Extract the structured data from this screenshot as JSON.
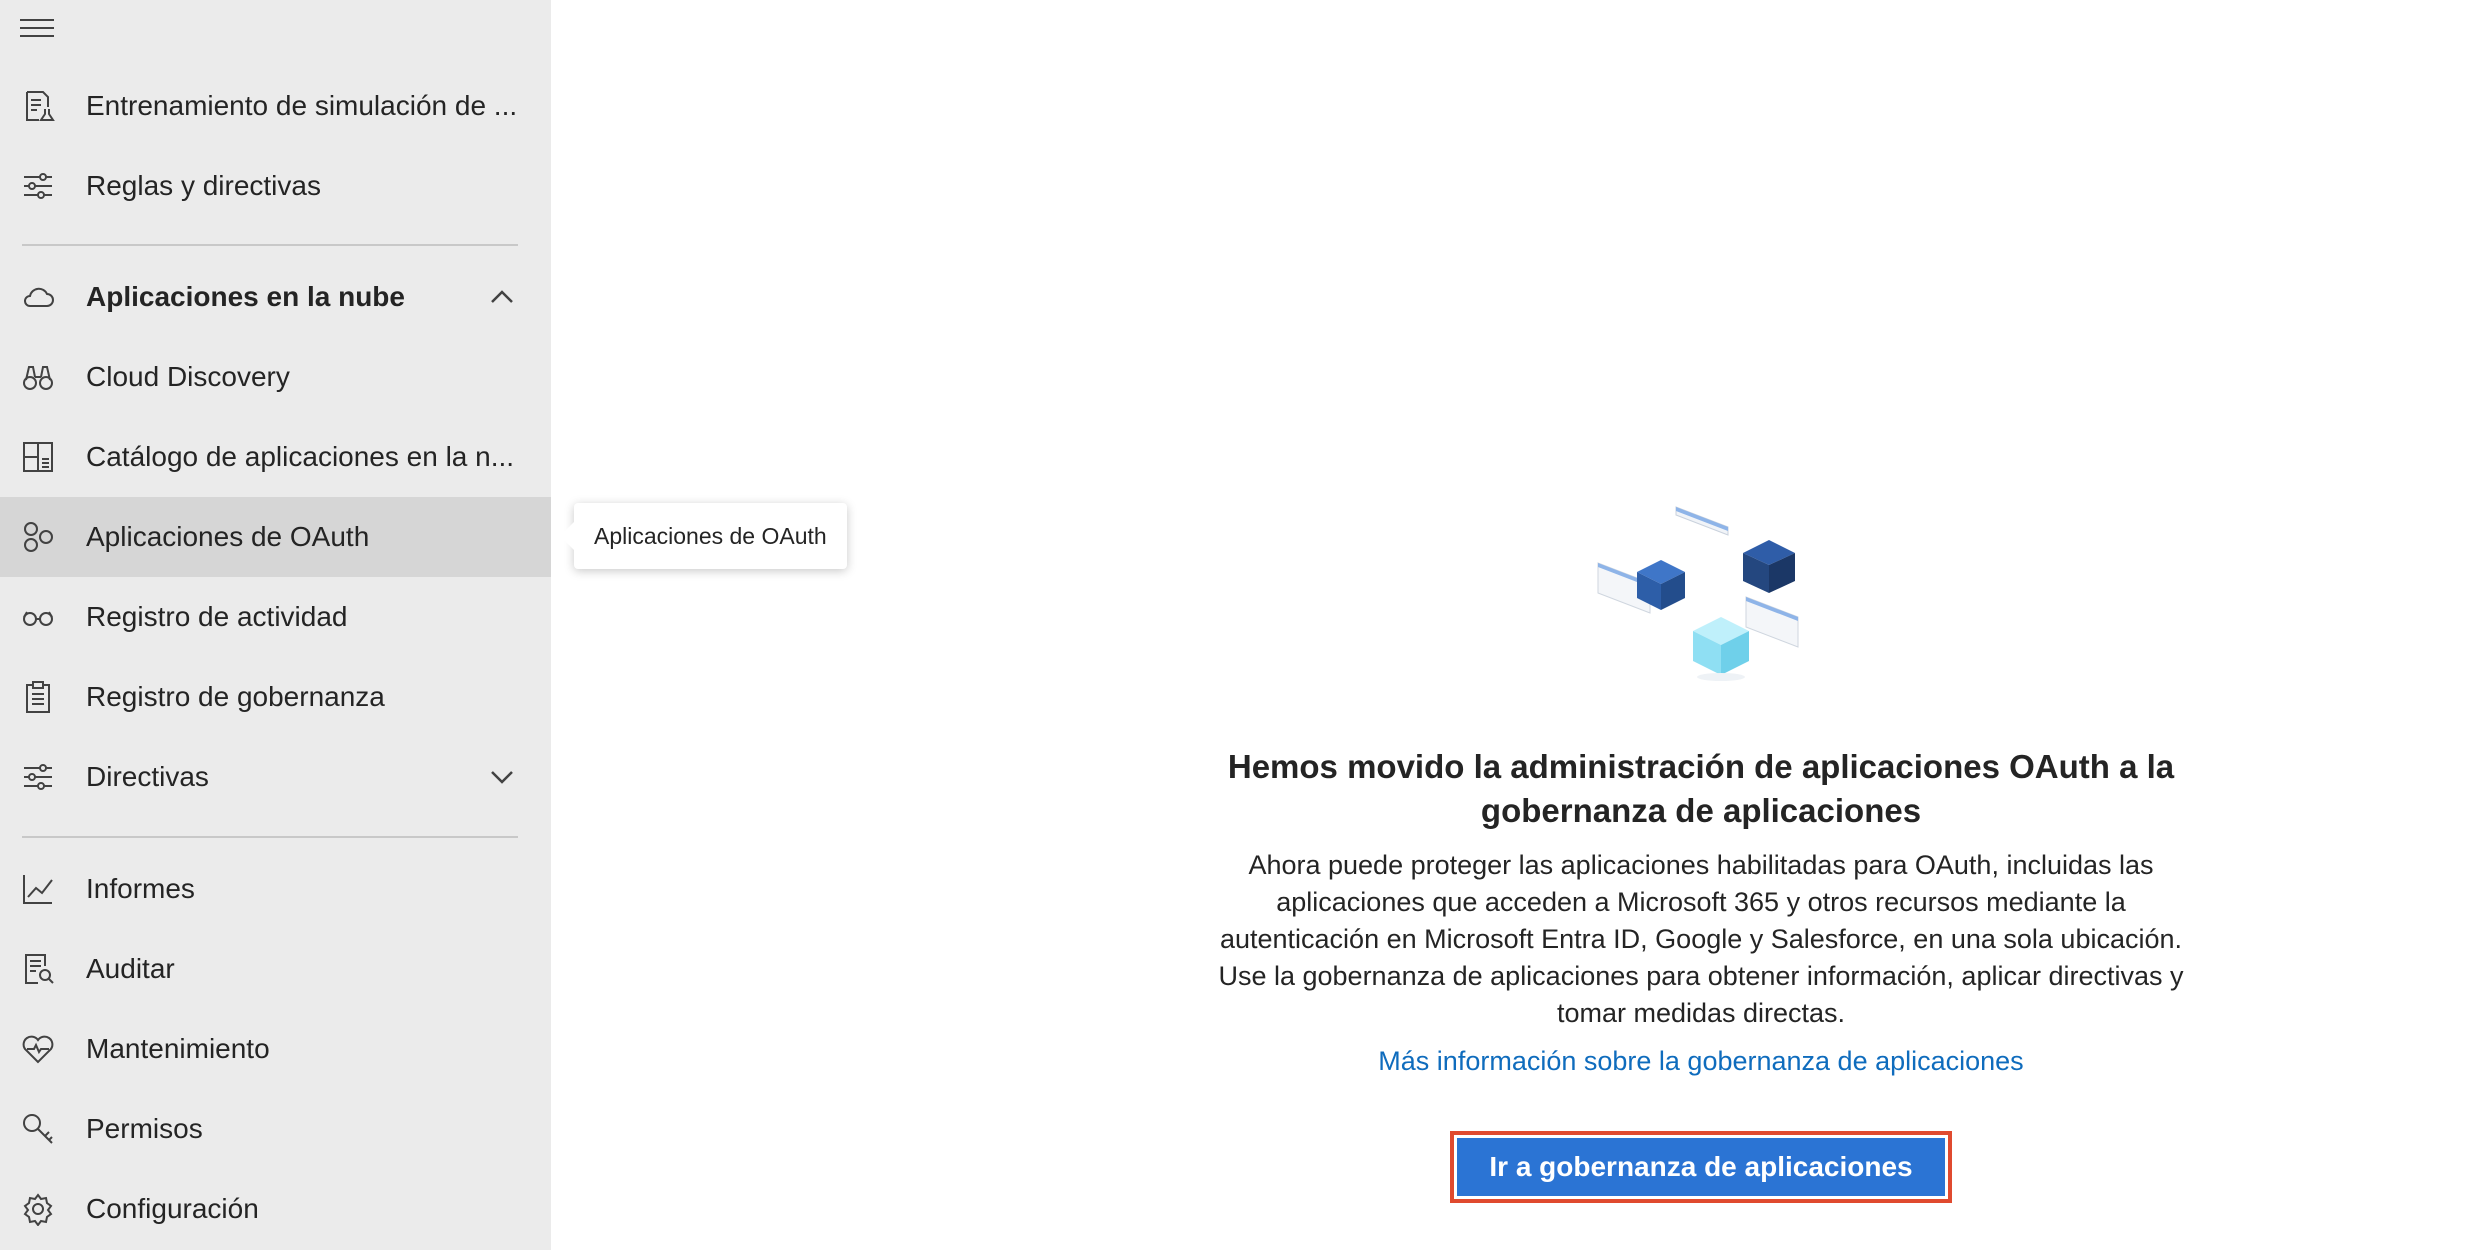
{
  "sidebar": {
    "items": [
      {
        "label": "Entrenamiento de simulación de ...",
        "icon": "lab-report-icon"
      },
      {
        "label": "Reglas y directivas",
        "icon": "sliders-icon"
      },
      {
        "label": "Aplicaciones en la nube",
        "icon": "cloud-icon",
        "expanded": true
      },
      {
        "label": "Cloud Discovery",
        "icon": "binoculars-icon"
      },
      {
        "label": "Catálogo de aplicaciones en la n...",
        "icon": "app-catalog-icon"
      },
      {
        "label": "Aplicaciones de OAuth",
        "icon": "oauth-apps-icon",
        "active": true
      },
      {
        "label": "Registro de actividad",
        "icon": "glasses-icon"
      },
      {
        "label": "Registro de gobernanza",
        "icon": "clipboard-icon"
      },
      {
        "label": "Directivas",
        "icon": "sliders-icon",
        "expanded": false
      },
      {
        "label": "Informes",
        "icon": "line-chart-icon"
      },
      {
        "label": "Auditar",
        "icon": "audit-icon"
      },
      {
        "label": "Mantenimiento",
        "icon": "heart-pulse-icon"
      },
      {
        "label": "Permisos",
        "icon": "key-icon"
      },
      {
        "label": "Configuración",
        "icon": "gear-icon"
      }
    ]
  },
  "tooltip": {
    "text": "Aplicaciones de OAuth"
  },
  "main": {
    "heading": "Hemos movido la administración de aplicaciones OAuth a la gobernanza de aplicaciones",
    "body": "Ahora puede proteger las aplicaciones habilitadas para OAuth, incluidas las aplicaciones que acceden a Microsoft 365 y otros recursos mediante la autenticación en Microsoft Entra ID, Google y Salesforce, en una sola ubicación. Use la gobernanza de aplicaciones para obtener información, aplicar directivas y tomar medidas directas.",
    "link": "Más información sobre la gobernanza de aplicaciones",
    "cta": "Ir a gobernanza de aplicaciones"
  },
  "colors": {
    "sidebar_bg": "#ebebeb",
    "active_bg": "#d6d6d6",
    "link": "#0f6cbd",
    "cta_bg": "#2b74d4",
    "highlight_border": "#e04a2f"
  }
}
